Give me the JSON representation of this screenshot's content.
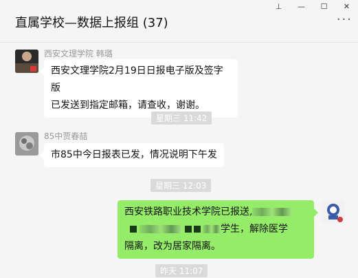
{
  "window": {
    "title": "直属学校—数据上报组 (37)",
    "controls": [
      "pin-icon",
      "minimize-icon",
      "maximize-icon",
      "close-icon"
    ],
    "pin_glyph": "⊥",
    "minimize_glyph": "—",
    "maximize_glyph": "☐",
    "close_glyph": "✕",
    "more_glyph": "···"
  },
  "messages": [
    {
      "sender": "西安文理学院  韩璐",
      "line1": "西安文理学院2月19日日报电子版及签字版",
      "line2": "已发送到指定邮箱，请查收，谢谢。"
    },
    {
      "time": "星期三 11:42"
    },
    {
      "sender": "85中贾春喆",
      "line1": "市85中今日报表已发，情况说明下午发"
    },
    {
      "time": "星期三 12:03"
    },
    {
      "line1_prefix": "西安铁路职业技术学院已报送,",
      "line2_suffix": "学生，解除医学",
      "line3": "隔离，改为居家隔离。"
    },
    {
      "time": "昨天 11:07"
    }
  ],
  "colors": {
    "background": "#f5f5f5",
    "bubble_in": "#ffffff",
    "bubble_out": "#95ec69",
    "timestamp_bg": "#dadada"
  }
}
